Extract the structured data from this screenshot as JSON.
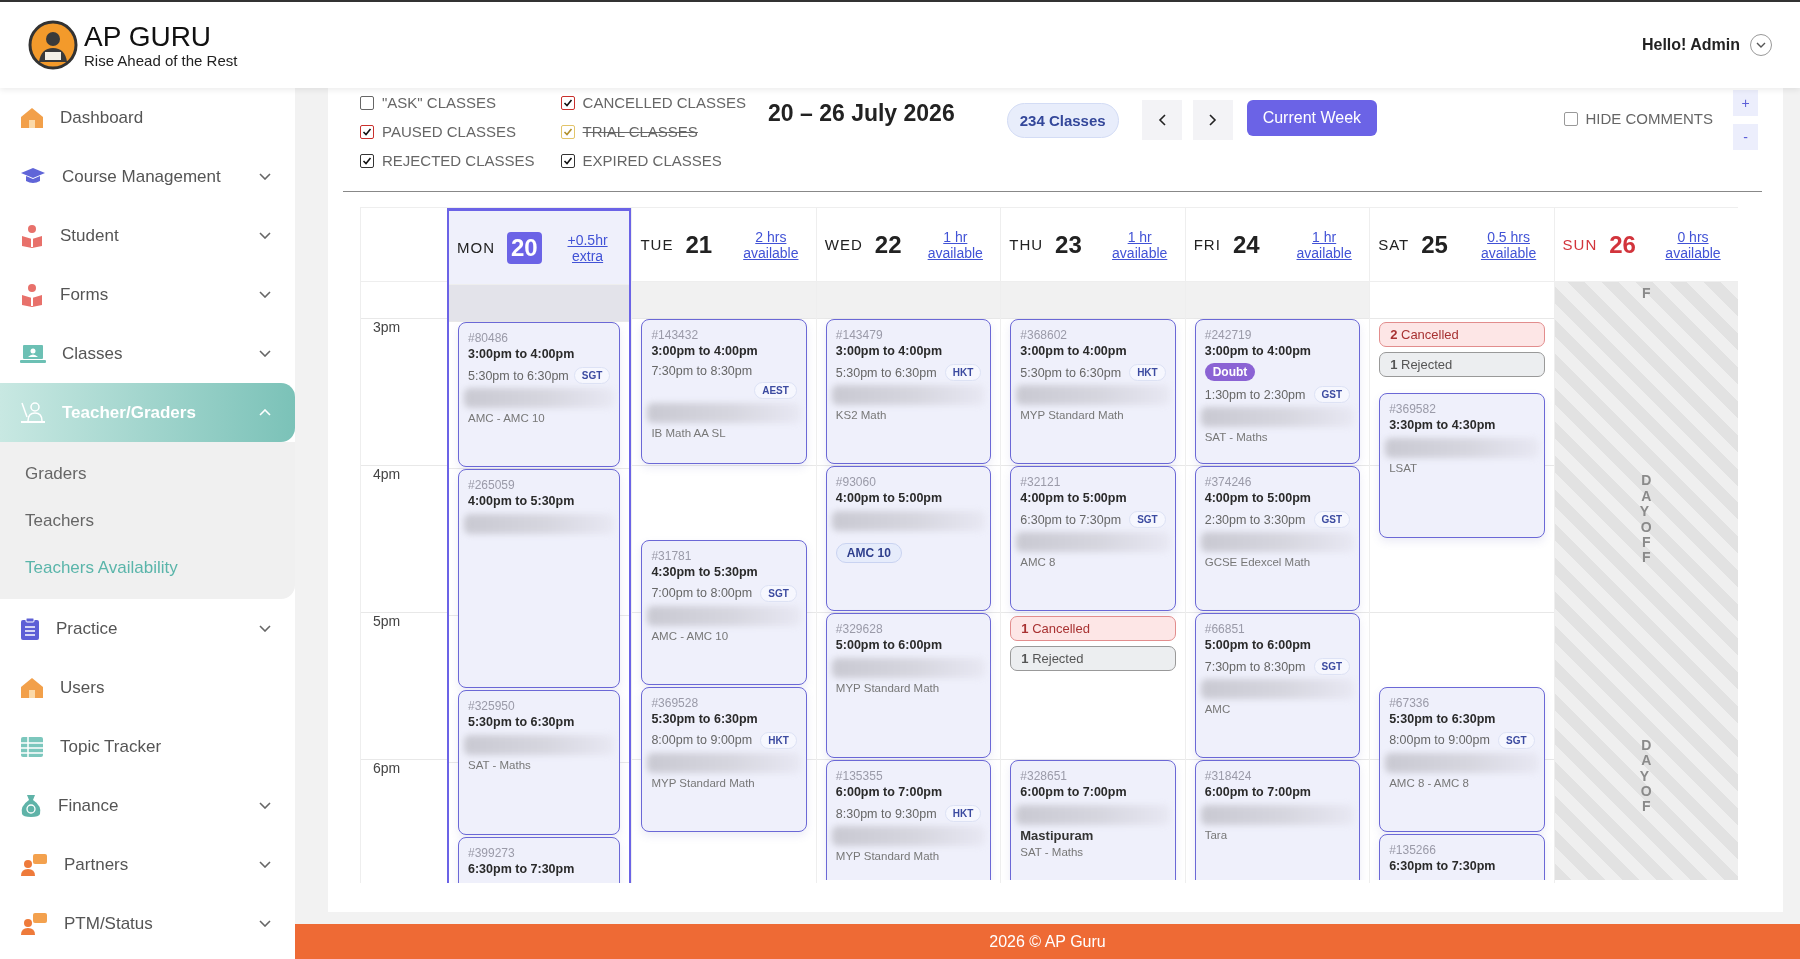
{
  "header": {
    "brand": "AP GURU",
    "tagline": "Rise Ahead of the Rest",
    "greeting": "Hello! Admin"
  },
  "sidebar": {
    "items": [
      {
        "label": "Dashboard",
        "selected": false
      },
      {
        "label": "Course Management",
        "expanded": false,
        "selected": false
      },
      {
        "label": "Student",
        "expanded": false,
        "selected": false
      },
      {
        "label": "Forms",
        "expanded": false,
        "selected": false
      },
      {
        "label": "Classes",
        "expanded": false,
        "selected": false
      },
      {
        "label": "Teacher/Graders",
        "expanded": true,
        "selected": true,
        "children": [
          {
            "label": "Graders",
            "selected": false
          },
          {
            "label": "Teachers",
            "selected": false
          },
          {
            "label": "Teachers Availability",
            "selected": true
          }
        ]
      },
      {
        "label": "Practice",
        "expanded": false,
        "selected": false
      },
      {
        "label": "Users",
        "selected": false
      },
      {
        "label": "Topic Tracker",
        "selected": false
      },
      {
        "label": "Finance",
        "expanded": false,
        "selected": false
      },
      {
        "label": "Partners",
        "expanded": false,
        "selected": false
      },
      {
        "label": "PTM/Status",
        "expanded": false,
        "selected": false
      }
    ]
  },
  "toolbar": {
    "filters": [
      {
        "label": "\"ASK\" CLASSES",
        "checked": false,
        "color": "#666666"
      },
      {
        "label": "PAUSED CLASSES",
        "checked": true,
        "color": "#c9302c"
      },
      {
        "label": "REJECTED CLASSES",
        "checked": true,
        "color": "#333333"
      },
      {
        "label": "CANCELLED CLASSES",
        "checked": true,
        "color": "#c9302c"
      },
      {
        "label": "TRIAL CLASSES",
        "checked": true,
        "color": "#e2c46a",
        "struck": true
      },
      {
        "label": "EXPIRED CLASSES",
        "checked": true,
        "color": "#333333"
      }
    ],
    "date_range": "20 – 26 July 2026",
    "class_count": "234 Classes",
    "current_week": "Current Week",
    "hide_comments": {
      "label": "HIDE COMMENTS",
      "checked": false
    },
    "zoom_controls": [
      "+",
      "-"
    ]
  },
  "calendar": {
    "hours": [
      "3pm",
      "4pm",
      "5pm",
      "6pm"
    ],
    "days": [
      {
        "name": "MON",
        "date": "20",
        "availability": "+0.5hr extra",
        "selected": true,
        "top_slot_greyed": true,
        "items": [
          {
            "kind": "class",
            "id": "#80486",
            "time": "3:00pm to 4:00pm",
            "alt_time": "5:30pm to 6:30pm",
            "timezone": "SGT",
            "redacted": true,
            "course": "AMC - AMC 10"
          },
          {
            "kind": "class",
            "id": "#265059",
            "time": "4:00pm to 5:30pm",
            "redacted": true
          },
          {
            "kind": "class",
            "id": "#325950",
            "time": "5:30pm to 6:30pm",
            "redacted": true,
            "course": "SAT - Maths"
          },
          {
            "kind": "class",
            "id": "#399273",
            "time": "6:30pm to 7:30pm"
          }
        ]
      },
      {
        "name": "TUE",
        "date": "21",
        "availability": "2 hrs available",
        "selected": false,
        "top_slot_greyed": true,
        "items": [
          {
            "kind": "class",
            "id": "#143432",
            "time": "3:00pm to 4:00pm",
            "alt_time": "7:30pm to 8:30pm",
            "timezone": "AEST",
            "redacted": true,
            "course": "IB Math AA SL"
          },
          {
            "kind": "class",
            "id": "#31781",
            "time": "4:30pm to 5:30pm",
            "alt_time": "7:00pm to 8:00pm",
            "timezone": "SGT",
            "redacted": true,
            "course": "AMC - AMC 10"
          },
          {
            "kind": "class",
            "id": "#369528",
            "time": "5:30pm to 6:30pm",
            "alt_time": "8:00pm to 9:00pm",
            "timezone": "HKT",
            "redacted": true,
            "course": "MYP Standard Math"
          }
        ]
      },
      {
        "name": "WED",
        "date": "22",
        "availability": "1 hr available",
        "selected": false,
        "top_slot_greyed": true,
        "items": [
          {
            "kind": "class",
            "id": "#143479",
            "time": "3:00pm to 4:00pm",
            "alt_time": "5:30pm to 6:30pm",
            "timezone": "HKT",
            "redacted": true,
            "course": "KS2 Math"
          },
          {
            "kind": "class",
            "id": "#93060",
            "time": "4:00pm to 5:00pm",
            "redacted": true,
            "course_tag": "AMC 10"
          },
          {
            "kind": "class",
            "id": "#329628",
            "time": "5:00pm to 6:00pm",
            "redacted": true,
            "course": "MYP Standard Math"
          },
          {
            "kind": "class",
            "id": "#135355",
            "time": "6:00pm to 7:00pm",
            "alt_time": "8:30pm to 9:30pm",
            "timezone": "HKT",
            "redacted": true,
            "course": "MYP Standard Math"
          }
        ]
      },
      {
        "name": "THU",
        "date": "23",
        "availability": "1 hr available",
        "selected": false,
        "top_slot_greyed": true,
        "items": [
          {
            "kind": "class",
            "id": "#368602",
            "time": "3:00pm to 4:00pm",
            "alt_time": "5:30pm to 6:30pm",
            "timezone": "HKT",
            "redacted": true,
            "course": "MYP Standard Math"
          },
          {
            "kind": "class",
            "id": "#32121",
            "time": "4:00pm to 5:00pm",
            "alt_time": "6:30pm to 7:30pm",
            "timezone": "SGT",
            "redacted": true,
            "course": "AMC 8"
          },
          {
            "kind": "cancelled",
            "count": "1",
            "label": "Cancelled"
          },
          {
            "kind": "rejected",
            "count": "1",
            "label": "Rejected"
          },
          {
            "kind": "class",
            "id": "#328651",
            "time": "6:00pm to 7:00pm",
            "redacted": true,
            "student": "Mastipuram",
            "course": "SAT - Maths"
          }
        ]
      },
      {
        "name": "FRI",
        "date": "24",
        "availability": "1 hr available",
        "selected": false,
        "top_slot_greyed": true,
        "items": [
          {
            "kind": "class",
            "id": "#242719",
            "time": "3:00pm to 4:00pm",
            "tag": "Doubt",
            "alt_time": "1:30pm to 2:30pm",
            "timezone": "GST",
            "redacted": true,
            "course": "SAT - Maths"
          },
          {
            "kind": "class",
            "id": "#374246",
            "time": "4:00pm to 5:00pm",
            "alt_time": "2:30pm to 3:30pm",
            "timezone": "GST",
            "redacted": true,
            "course": "GCSE Edexcel Math"
          },
          {
            "kind": "class",
            "id": "#66851",
            "time": "5:00pm to 6:00pm",
            "alt_time": "7:30pm to 8:30pm",
            "timezone": "SGT",
            "redacted": true,
            "course": "AMC"
          },
          {
            "kind": "class",
            "id": "#318424",
            "time": "6:00pm to 7:00pm",
            "redacted": true,
            "course": "Tara"
          }
        ]
      },
      {
        "name": "SAT",
        "date": "25",
        "availability": "0.5 hrs available",
        "selected": false,
        "top_slot_greyed": false,
        "items": [
          {
            "kind": "cancelled",
            "count": "2",
            "label": "Cancelled"
          },
          {
            "kind": "rejected",
            "count": "1",
            "label": "Rejected"
          },
          {
            "kind": "class",
            "id": "#369582",
            "time": "3:30pm to 4:30pm",
            "redacted": true,
            "course": "LSAT"
          },
          {
            "kind": "class",
            "id": "#67336",
            "time": "5:30pm to 6:30pm",
            "alt_time": "8:00pm to 9:00pm",
            "timezone": "SGT",
            "redacted": true,
            "course": "AMC 8 - AMC 8"
          },
          {
            "kind": "class",
            "id": "#135266",
            "time": "6:30pm to 7:30pm"
          }
        ]
      },
      {
        "name": "SUN",
        "date": "26",
        "availability": "0 hrs available",
        "selected": false,
        "day_off": true,
        "day_off_labels": [
          "F",
          "DAY OFF",
          "DAY OF"
        ]
      }
    ]
  },
  "footer": {
    "text": "2026 © AP Guru"
  }
}
